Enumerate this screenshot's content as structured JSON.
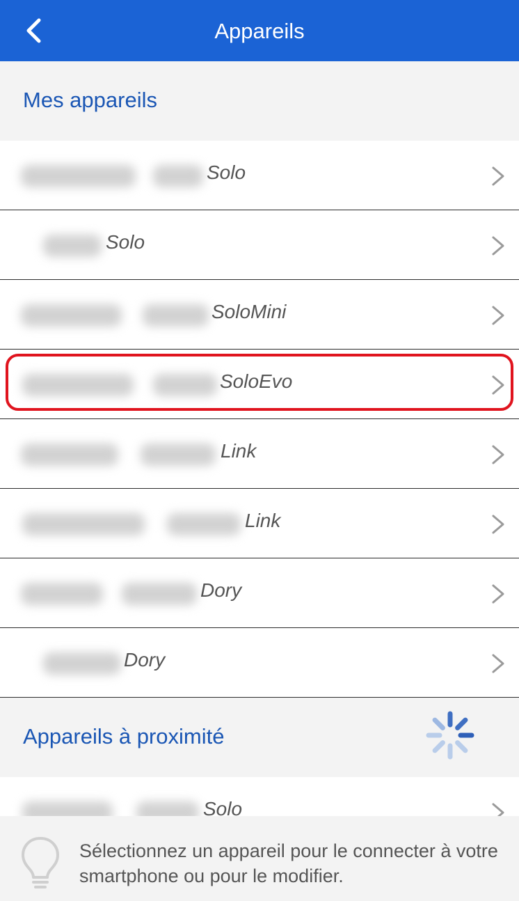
{
  "header": {
    "title": "Appareils",
    "back_icon": "chevron-left-icon"
  },
  "sections": {
    "my_devices": "Mes appareils",
    "nearby_devices": "Appareils à proximité"
  },
  "my_devices": [
    {
      "type": "Solo"
    },
    {
      "type": "Solo"
    },
    {
      "type": "SoloMini"
    },
    {
      "type": "SoloEvo",
      "highlighted": true
    },
    {
      "type": "Link"
    },
    {
      "type": "Link"
    },
    {
      "type": "Dory"
    },
    {
      "type": "Dory"
    }
  ],
  "nearby": [
    {
      "type": "Solo"
    }
  ],
  "footer": {
    "icon": "lightbulb-icon",
    "hint": "Sélectionnez un appareil pour le connecter à votre smartphone ou pour le modifier."
  },
  "colors": {
    "header": "#1b63d5",
    "section_text": "#1a56b4",
    "highlight": "#e0141e"
  }
}
